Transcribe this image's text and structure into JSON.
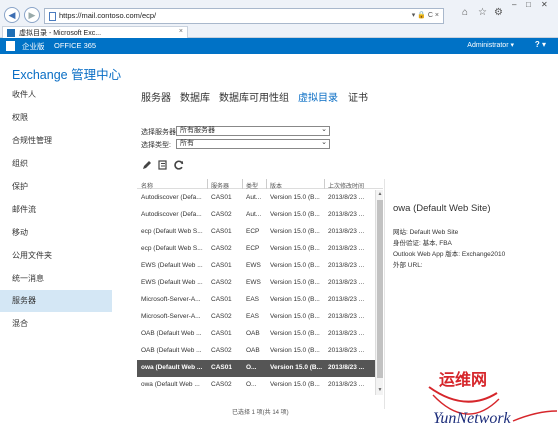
{
  "browser": {
    "url": "https://mail.contoso.com/ecp/",
    "address_tools": "▾ 🔒 C ×",
    "tab_title": "虚拟目录 - Microsoft Exc...",
    "tab_close": "×"
  },
  "o365": {
    "brand": "企业版",
    "product": "OFFICE 365",
    "user": "Administrator ▾",
    "help": "? ▾"
  },
  "app": {
    "title": "Exchange 管理中心"
  },
  "nav": {
    "items": [
      {
        "label": "收件人"
      },
      {
        "label": "权限"
      },
      {
        "label": "合规性管理"
      },
      {
        "label": "组织"
      },
      {
        "label": "保护"
      },
      {
        "label": "邮件流"
      },
      {
        "label": "移动"
      },
      {
        "label": "公用文件夹"
      },
      {
        "label": "统一消息"
      },
      {
        "label": "服务器"
      },
      {
        "label": "混合"
      }
    ],
    "selected_index": 9
  },
  "tabs": [
    {
      "label": "服务器"
    },
    {
      "label": "数据库"
    },
    {
      "label": "数据库可用性组"
    },
    {
      "label": "虚拟目录"
    },
    {
      "label": "证书"
    }
  ],
  "active_tab_index": 3,
  "filters": {
    "server_label": "选择服务器:",
    "server_value": "所有服务器",
    "type_label": "选择类型:",
    "type_value": "所有"
  },
  "table": {
    "headers": [
      "名称",
      "服务器",
      "类型",
      "版本",
      "上次修改时间"
    ],
    "rows": [
      [
        "Autodiscover (Defa...",
        "CAS01",
        "Aut...",
        "Version 15.0 (B...",
        "2013/8/23 ..."
      ],
      [
        "Autodiscover (Defa...",
        "CAS02",
        "Aut...",
        "Version 15.0 (B...",
        "2013/8/23 ..."
      ],
      [
        "ecp (Default Web S...",
        "CAS01",
        "ECP",
        "Version 15.0 (B...",
        "2013/8/23 ..."
      ],
      [
        "ecp (Default Web S...",
        "CAS02",
        "ECP",
        "Version 15.0 (B...",
        "2013/8/23 ..."
      ],
      [
        "EWS (Default Web ...",
        "CAS01",
        "EWS",
        "Version 15.0 (B...",
        "2013/8/23 ..."
      ],
      [
        "EWS (Default Web ...",
        "CAS02",
        "EWS",
        "Version 15.0 (B...",
        "2013/8/23 ..."
      ],
      [
        "Microsoft-Server-A...",
        "CAS01",
        "EAS",
        "Version 15.0 (B...",
        "2013/8/23 ..."
      ],
      [
        "Microsoft-Server-A...",
        "CAS02",
        "EAS",
        "Version 15.0 (B...",
        "2013/8/23 ..."
      ],
      [
        "OAB (Default Web ...",
        "CAS01",
        "OAB",
        "Version 15.0 (B...",
        "2013/8/23 ..."
      ],
      [
        "OAB (Default Web ...",
        "CAS02",
        "OAB",
        "Version 15.0 (B...",
        "2013/8/23 ..."
      ],
      [
        "owa (Default Web ...",
        "CAS01",
        "O...",
        "Version 15.0 (B...",
        "2013/8/23 ..."
      ],
      [
        "owa (Default Web ...",
        "CAS02",
        "O...",
        "Version 15.0 (B...",
        "2013/8/23 ..."
      ]
    ],
    "selected_row_index": 10,
    "status": "已选择 1 项(共 14 项)"
  },
  "details": {
    "title": "owa (Default Web Site)",
    "lines": [
      "网站: Default Web Site",
      "身份验证: 基本, FBA",
      "Outlook Web App 版本: Exchange2010",
      "外部 URL:"
    ]
  },
  "watermark": {
    "text_cn": "运维网",
    "text_en": "YunNetwork"
  },
  "colors": {
    "accent": "#0a6ec5",
    "o365_bar": "#0072c6",
    "nav_selected": "#d4e7f5",
    "row_selected": "#555555",
    "watermark_red": "#d6262b"
  }
}
